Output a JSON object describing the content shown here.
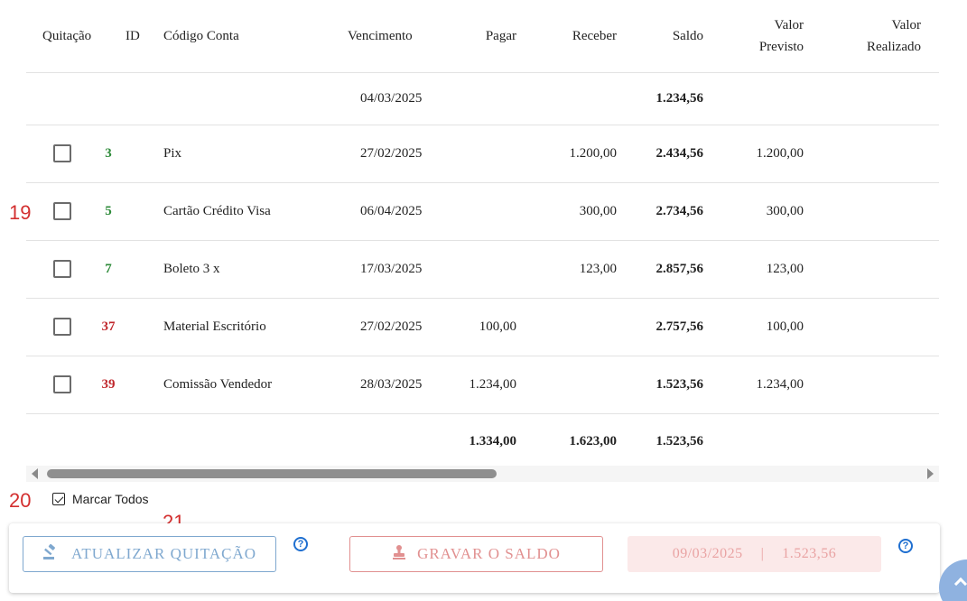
{
  "table": {
    "headers": {
      "quitacao": "Quitação",
      "id": "ID",
      "codigo_conta": "Código Conta",
      "vencimento": "Vencimento",
      "pagar": "Pagar",
      "receber": "Receber",
      "saldo": "Saldo",
      "valor_previsto_1": "Valor",
      "valor_previsto_2": "Previsto",
      "valor_realizado_1": "Valor",
      "valor_realizado_2": "Realizado"
    },
    "opening": {
      "vencimento": "04/03/2025",
      "saldo": "1.234,56"
    },
    "rows": [
      {
        "id": "3",
        "id_color": "#2e8b3a",
        "codigo": "Pix",
        "vencimento": "27/02/2025",
        "pagar": "",
        "receber": "1.200,00",
        "saldo": "2.434,56",
        "previsto": "1.200,00",
        "realizado": ""
      },
      {
        "id": "5",
        "id_color": "#2e8b3a",
        "codigo": "Cartão Crédito Visa",
        "vencimento": "06/04/2025",
        "pagar": "",
        "receber": "300,00",
        "saldo": "2.734,56",
        "previsto": "300,00",
        "realizado": ""
      },
      {
        "id": "7",
        "id_color": "#2e8b3a",
        "codigo": "Boleto 3 x",
        "vencimento": "17/03/2025",
        "pagar": "",
        "receber": "123,00",
        "saldo": "2.857,56",
        "previsto": "123,00",
        "realizado": ""
      },
      {
        "id": "37",
        "id_color": "#c0282d",
        "codigo": "Material Escritório",
        "vencimento": "27/02/2025",
        "pagar": "100,00",
        "receber": "",
        "saldo": "2.757,56",
        "previsto": "100,00",
        "realizado": ""
      },
      {
        "id": "39",
        "id_color": "#c0282d",
        "codigo": "Comissão Vendedor",
        "vencimento": "28/03/2025",
        "pagar": "1.234,00",
        "receber": "",
        "saldo": "1.523,56",
        "previsto": "1.234,00",
        "realizado": ""
      }
    ],
    "totals": {
      "pagar": "1.334,00",
      "receber": "1.623,00",
      "saldo": "1.523,56"
    }
  },
  "markers": {
    "m19": "19",
    "m20": "20",
    "m21": "21"
  },
  "marcar_todos": {
    "label": "Marcar Todos",
    "checked": true
  },
  "actions": {
    "atualizar_label": "ATUALIZAR QUITAÇÃO",
    "gravar_label": "GRAVAR O SALDO",
    "saldo_date": "09/03/2025",
    "saldo_sep": "|",
    "saldo_value": "1.523,56",
    "info_glyph": "?"
  },
  "colors": {
    "accent_blue": "#7fa8cf",
    "accent_red": "#e19090",
    "green_id": "#2e8b3a",
    "red_id": "#c0282d"
  }
}
